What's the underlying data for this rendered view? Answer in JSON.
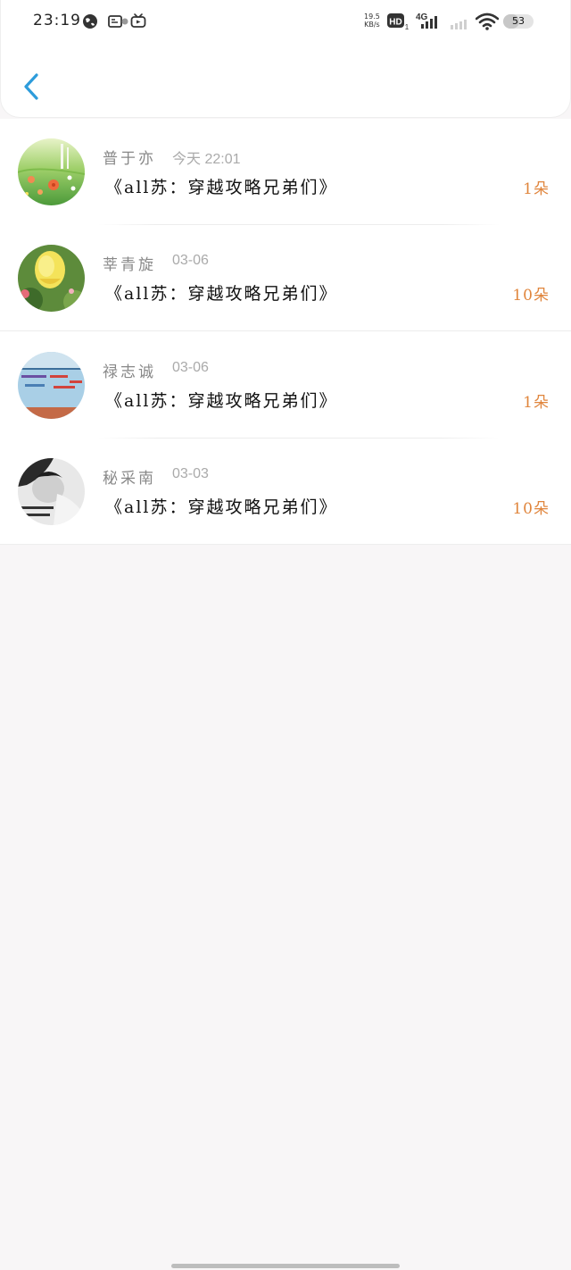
{
  "status_bar": {
    "time": "23:19",
    "net_speed_value": "19.5",
    "net_speed_unit": "KB/s",
    "hd_label": "HD",
    "hd_sub": "1",
    "network_type": "4G",
    "battery_level": "53",
    "battery_fraction": 0.53,
    "icons": [
      "globe-icon",
      "screen-record-icon",
      "dot-icon",
      "tv-icon",
      "hd-icon",
      "signal-icon",
      "signal-weak-icon",
      "wifi-icon",
      "battery-icon"
    ]
  },
  "header": {
    "back_icon": "chevron-left-icon",
    "accent_color": "#2d9cdb"
  },
  "list": {
    "items": [
      {
        "name": "普于亦",
        "date": "今天 22:01",
        "title": "《all苏：穿越攻略兄弟们》",
        "count": "1朵",
        "avatar": "flower-field-avatar"
      },
      {
        "name": "莘青旋",
        "date": "03-06",
        "title": "《all苏：穿越攻略兄弟们》",
        "count": "10朵",
        "avatar": "yellow-rose-avatar"
      },
      {
        "name": "禄志诚",
        "date": "03-06",
        "title": "《all苏：穿越攻略兄弟们》",
        "count": "1朵",
        "avatar": "sky-text-avatar"
      },
      {
        "name": "秘采南",
        "date": "03-03",
        "title": "《all苏：穿越攻略兄弟们》",
        "count": "10朵",
        "avatar": "bw-portrait-avatar"
      }
    ],
    "count_color": "#e0853c"
  }
}
